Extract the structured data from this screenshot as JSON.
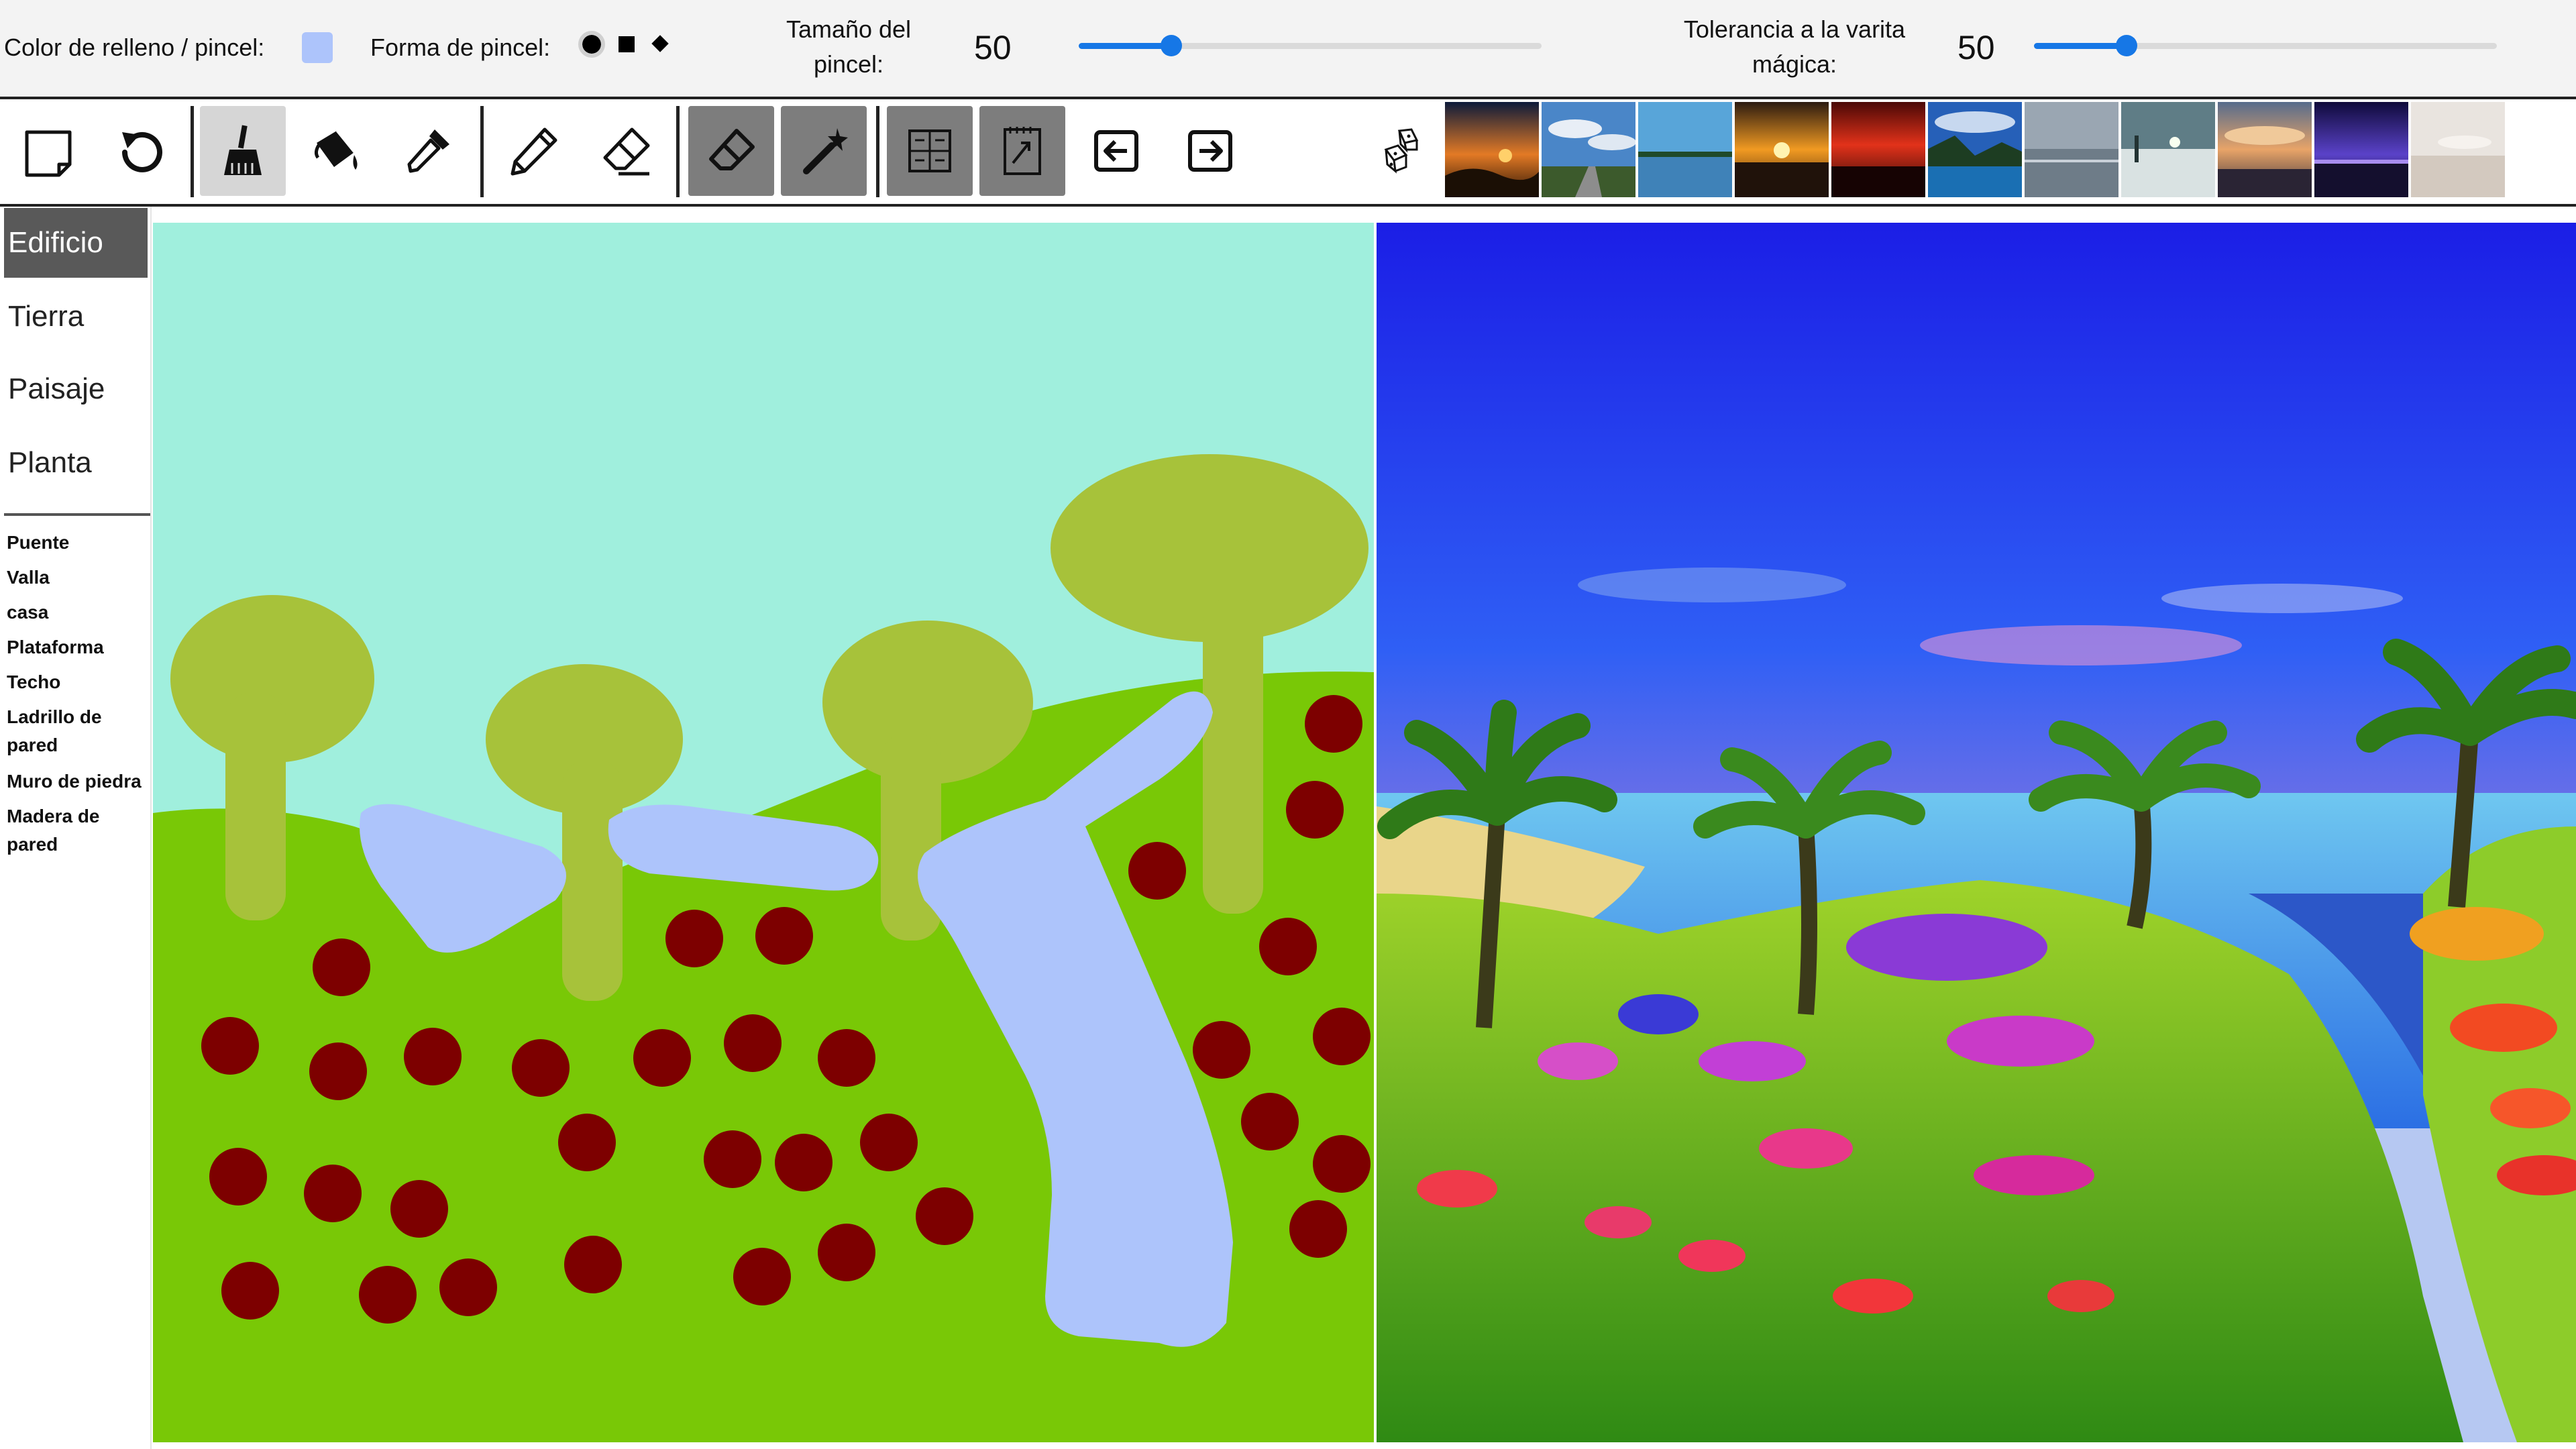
{
  "options": {
    "fill_label": "Color de relleno / pincel:",
    "fill_color": "#adc4fb",
    "shape_label": "Forma de pincel:",
    "shapes": [
      "circle",
      "square",
      "diamond"
    ],
    "size_label": "Tamaño del pincel:",
    "size_value": "50",
    "size_fraction": 0.2,
    "wand_label": "Tolerancia a la varita mágica:",
    "wand_value": "50",
    "wand_fraction": 0.2
  },
  "toolbar": {
    "tools": [
      "new-canvas",
      "undo",
      "brush",
      "paint-bucket",
      "eyedropper",
      "pencil",
      "eraser",
      "erase-fill",
      "magic-wand",
      "segment-map",
      "generate",
      "previous",
      "next",
      "random-dice"
    ],
    "selected_tool": "brush",
    "sample_thumbnails": 11
  },
  "categories": {
    "items": [
      "Edificio",
      "Tierra",
      "Paisaje",
      "Planta"
    ],
    "selected": "Edificio"
  },
  "materials": [
    "Puente",
    "Valla",
    "casa",
    "Plataforma",
    "Techo",
    "Ladrillo de pared",
    "Muro de piedra",
    "Madera de pared"
  ],
  "colors": {
    "sky": "#a0efdd",
    "grass": "#79c806",
    "tree": "#a7c23a",
    "water": "#adc4fb",
    "flower": "#7d0000",
    "accent": "#1677e6"
  }
}
